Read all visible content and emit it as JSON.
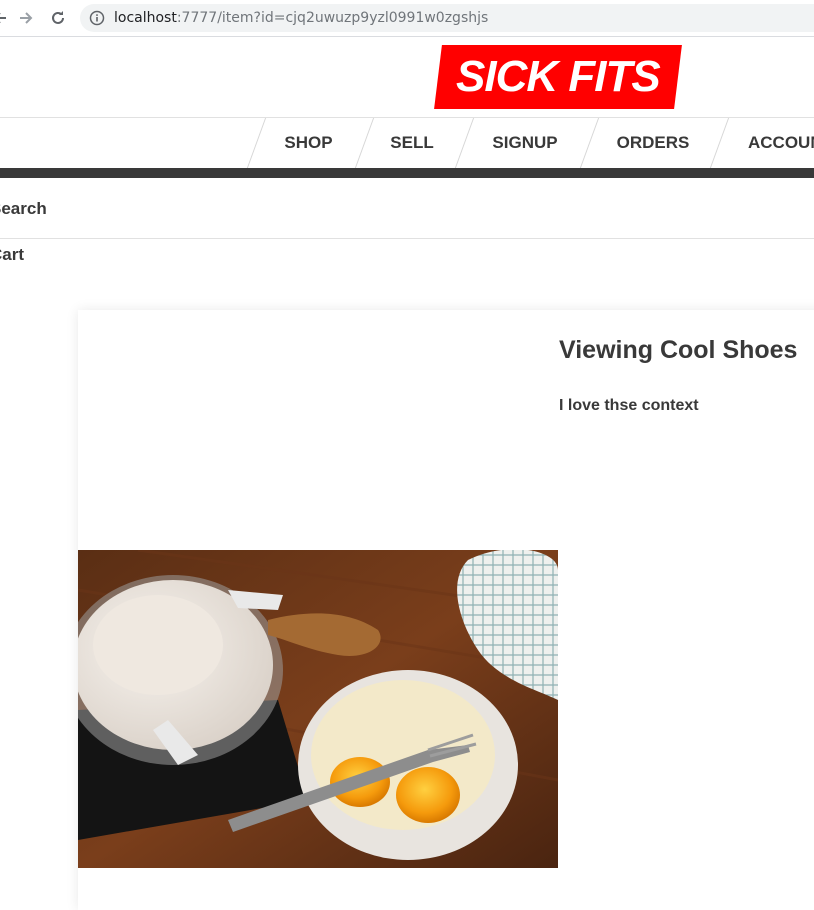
{
  "browser": {
    "url_host": "localhost",
    "url_rest": ":7777/item?id=cjq2uwuzp9yzl0991w0zgshjs",
    "icons": [
      "back-icon",
      "forward-icon",
      "reload-icon",
      "info-icon"
    ]
  },
  "site": {
    "logo": "SICK FITS",
    "brand_color": "#ff0000",
    "nav": [
      "SHOP",
      "SELL",
      "SIGNUP",
      "ORDERS",
      "ACCOUNT"
    ],
    "search_label": "Search",
    "cart_label": "Cart"
  },
  "item": {
    "title": "Viewing Cool Shoes",
    "description": "I love thse context",
    "image": "bowl-of-eggs-and-flour-photo"
  }
}
